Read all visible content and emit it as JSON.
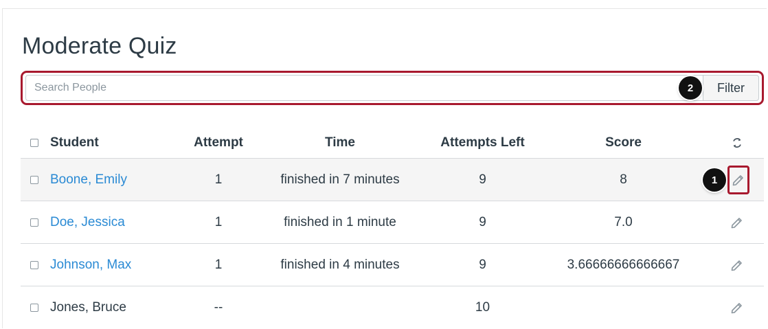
{
  "page": {
    "title": "Moderate Quiz"
  },
  "search": {
    "placeholder": "Search People",
    "value": "",
    "filter_label": "Filter"
  },
  "callouts": {
    "filter": "2",
    "edit": "1"
  },
  "table": {
    "headers": {
      "student": "Student",
      "attempt": "Attempt",
      "time": "Time",
      "attempts_left": "Attempts Left",
      "score": "Score"
    },
    "rows": [
      {
        "student": "Boone, Emily",
        "attempt": "1",
        "time": "finished in 7 minutes",
        "attempts_left": "9",
        "score": "8"
      },
      {
        "student": "Doe, Jessica",
        "attempt": "1",
        "time": "finished in 1 minute",
        "attempts_left": "9",
        "score": "7.0"
      },
      {
        "student": "Johnson, Max",
        "attempt": "1",
        "time": "finished in 4 minutes",
        "attempts_left": "9",
        "score": "3.66666666666667"
      },
      {
        "student": "Jones, Bruce",
        "attempt": "--",
        "time": "",
        "attempts_left": "10",
        "score": ""
      }
    ]
  },
  "icons": {
    "refresh": "refresh-icon",
    "edit": "pencil-icon"
  },
  "colors": {
    "link": "#2a8ad4",
    "highlight": "#a8192e",
    "text": "#2d3b45",
    "row_shade": "#f5f5f5"
  }
}
